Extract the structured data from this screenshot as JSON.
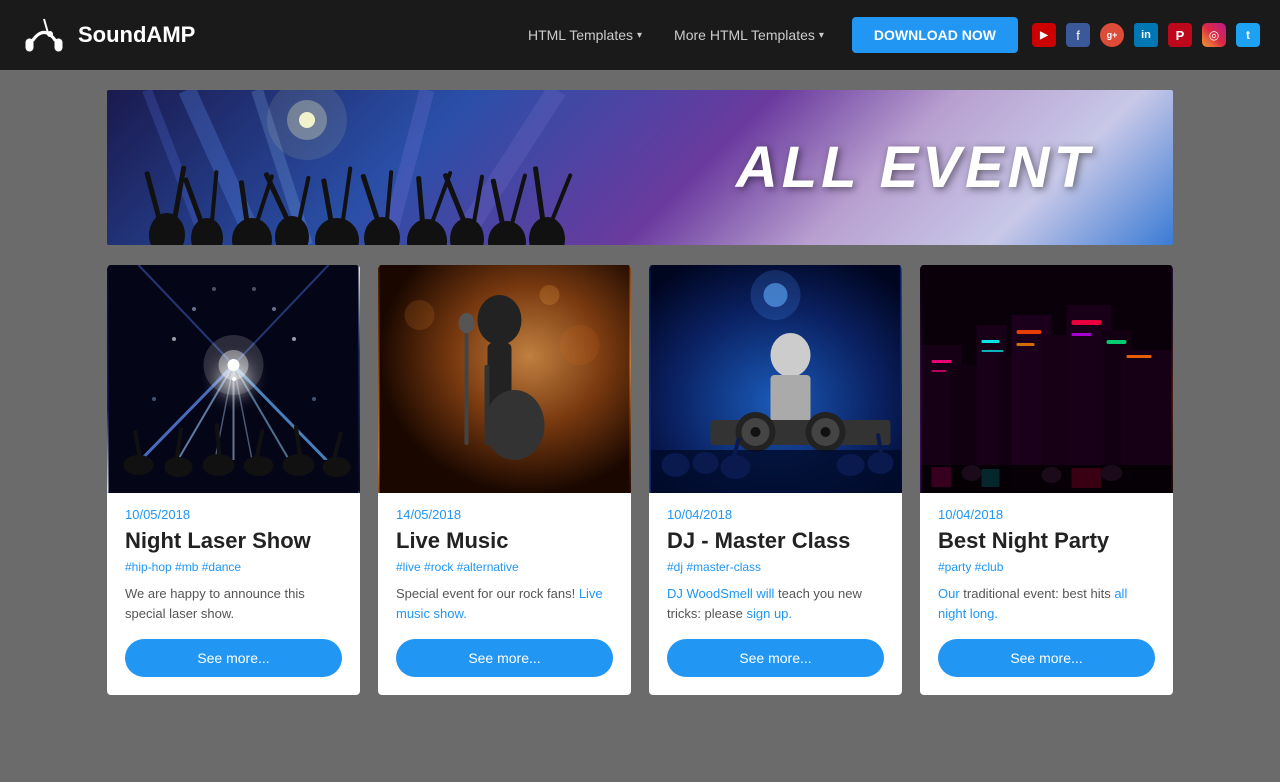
{
  "brand": {
    "name": "SoundAMP"
  },
  "nav": {
    "html_templates_label": "HTML Templates",
    "more_templates_label": "More HTML Templates",
    "download_btn_label": "DOWNLOAD NOW"
  },
  "social": {
    "icons": [
      {
        "name": "youtube-icon",
        "label": "▶",
        "class": "si-yt"
      },
      {
        "name": "facebook-icon",
        "label": "f",
        "class": "si-fb"
      },
      {
        "name": "google-plus-icon",
        "label": "g+",
        "class": "si-gp"
      },
      {
        "name": "linkedin-icon",
        "label": "in",
        "class": "si-li"
      },
      {
        "name": "pinterest-icon",
        "label": "P",
        "class": "si-pi"
      },
      {
        "name": "instagram-icon",
        "label": "◎",
        "class": "si-ig"
      },
      {
        "name": "twitter-icon",
        "label": "t",
        "class": "si-tw"
      }
    ]
  },
  "hero": {
    "title": "ALL EVENT"
  },
  "events": [
    {
      "date": "10/05/2018",
      "title": "Night Laser Show",
      "tags": "#hip-hop #mb #dance",
      "description": "We are happy to announce this special laser show.",
      "btn_label": "See more...",
      "img_class": "img-laser"
    },
    {
      "date": "14/05/2018",
      "title": "Live Music",
      "tags": "#live #rock #alternative",
      "description": "Special event for our rock fans! Live music show.",
      "btn_label": "See more...",
      "img_class": "img-music",
      "desc_has_link": true
    },
    {
      "date": "10/04/2018",
      "title": "DJ - Master Class",
      "tags": "#dj #master-class",
      "description": "DJ WoodSmell will teach you new tricks: please sign up.",
      "btn_label": "See more...",
      "img_class": "img-dj",
      "desc_has_link": true
    },
    {
      "date": "10/04/2018",
      "title": "Best Night Party",
      "tags": "#party #club",
      "description": "Our traditional event: best hits all night long.",
      "btn_label": "See more...",
      "img_class": "img-party",
      "desc_has_link": true
    }
  ]
}
